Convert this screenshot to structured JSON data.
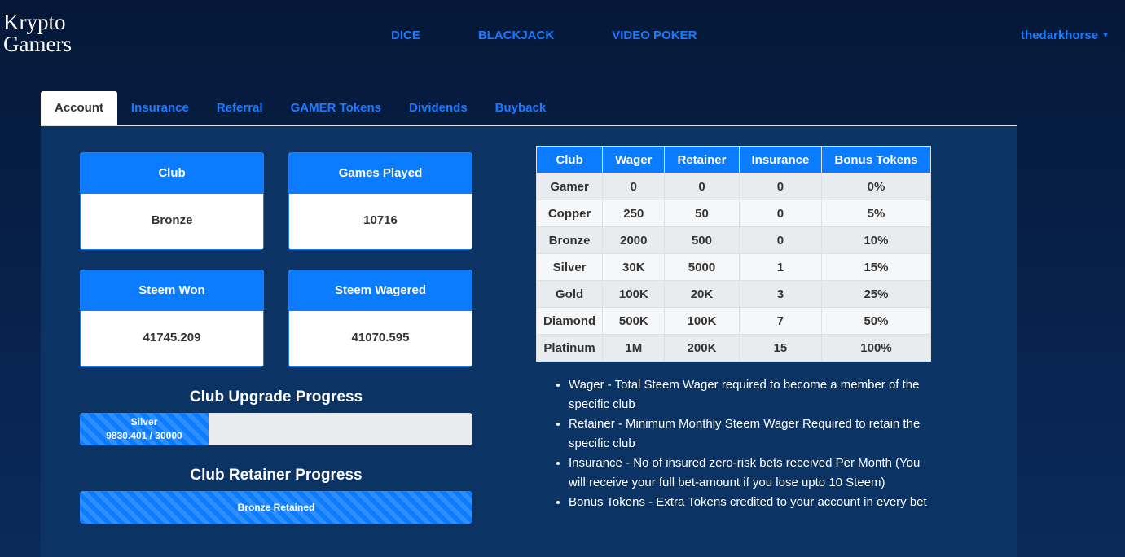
{
  "brand": {
    "line1": "Krypto",
    "line2": "Gamers"
  },
  "nav": [
    {
      "label": "DICE"
    },
    {
      "label": "BLACKJACK"
    },
    {
      "label": "VIDEO POKER"
    }
  ],
  "user": {
    "name": "thedarkhorse"
  },
  "tabs": [
    {
      "label": "Account",
      "active": true
    },
    {
      "label": "Insurance"
    },
    {
      "label": "Referral"
    },
    {
      "label": "GAMER Tokens"
    },
    {
      "label": "Dividends"
    },
    {
      "label": "Buyback"
    }
  ],
  "cards": [
    {
      "title": "Club",
      "value": "Bronze"
    },
    {
      "title": "Games Played",
      "value": "10716"
    },
    {
      "title": "Steem Won",
      "value": "41745.209"
    },
    {
      "title": "Steem Wagered",
      "value": "41070.595"
    }
  ],
  "upgrade": {
    "title": "Club Upgrade Progress",
    "bar_label": "Silver",
    "bar_value": "9830.401 / 30000",
    "progress": 0.3277
  },
  "retainer": {
    "title": "Club Retainer Progress",
    "bar_label": "Bronze Retained",
    "progress": 1.0
  },
  "club_table": {
    "headers": [
      "Club",
      "Wager",
      "Retainer",
      "Insurance",
      "Bonus Tokens"
    ],
    "rows": [
      [
        "Gamer",
        "0",
        "0",
        "0",
        "0%"
      ],
      [
        "Copper",
        "250",
        "50",
        "0",
        "5%"
      ],
      [
        "Bronze",
        "2000",
        "500",
        "0",
        "10%"
      ],
      [
        "Silver",
        "30K",
        "5000",
        "1",
        "15%"
      ],
      [
        "Gold",
        "100K",
        "20K",
        "3",
        "25%"
      ],
      [
        "Diamond",
        "500K",
        "100K",
        "7",
        "50%"
      ],
      [
        "Platinum",
        "1M",
        "200K",
        "15",
        "100%"
      ]
    ]
  },
  "notes": [
    "Wager - Total Steem Wager required to become a member of the specific club",
    "Retainer - Minimum Monthly Steem Wager Required to retain the specific club",
    "Insurance - No of insured zero-risk bets received Per Month (You will receive your full bet-amount if you lose upto 10 Steem)",
    "Bonus Tokens - Extra Tokens credited to your account in every bet"
  ],
  "colors": {
    "accent": "#0b7bff",
    "panel": "#0b3364",
    "link": "#1a7bff"
  }
}
